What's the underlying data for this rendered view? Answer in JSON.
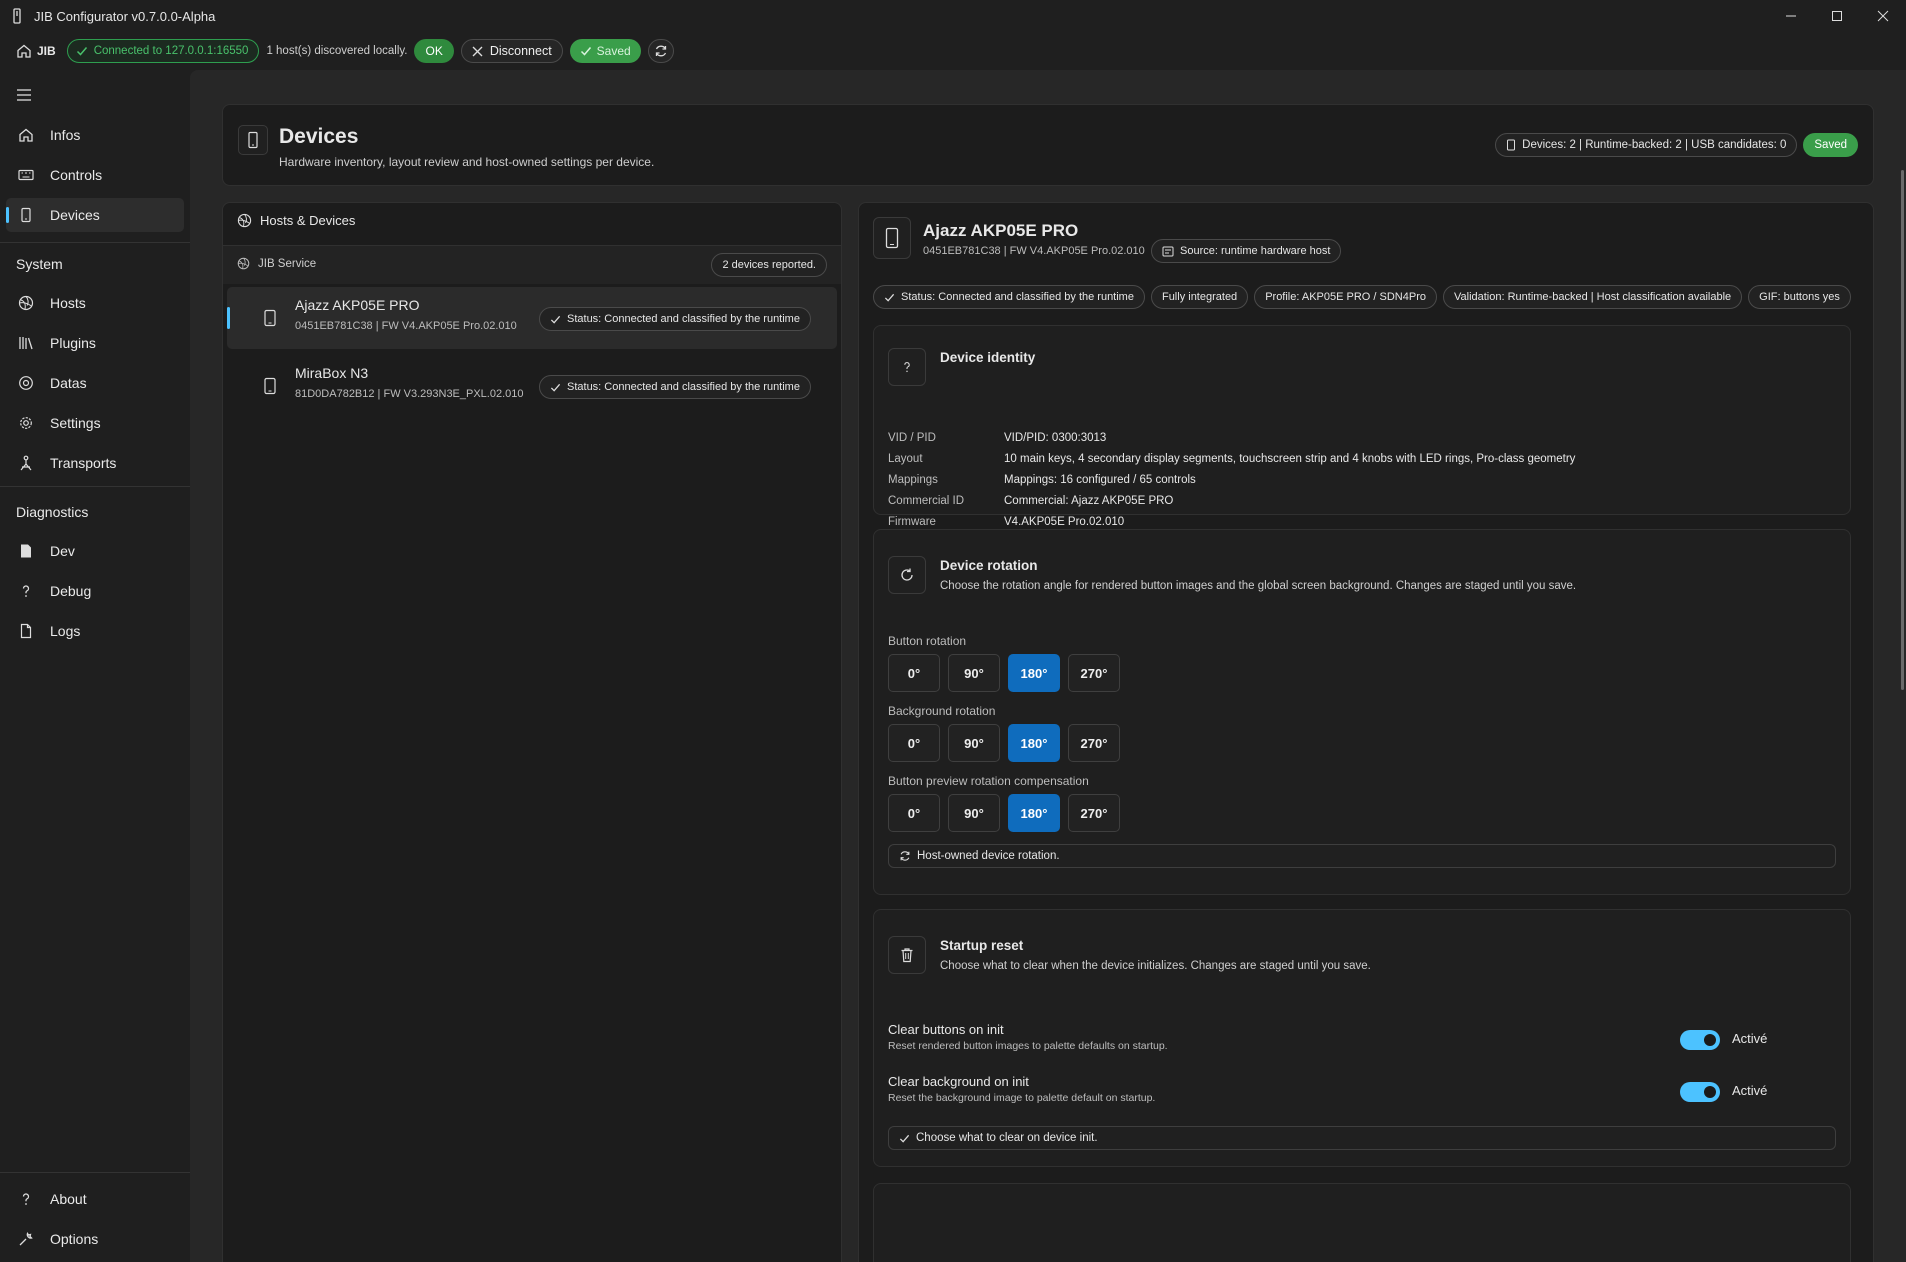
{
  "window": {
    "title": "JIB Configurator v0.7.0.0-Alpha"
  },
  "toolbar": {
    "home_label": "JIB",
    "connection": "Connected to 127.0.0.1:16550",
    "discovered": "1 host(s) discovered locally.",
    "ok_label": "OK",
    "disconnect_label": "Disconnect",
    "saved_label": "Saved"
  },
  "sidebar": {
    "top_items": [
      {
        "label": "Infos",
        "icon": "home-icon"
      },
      {
        "label": "Controls",
        "icon": "keyboard-icon"
      },
      {
        "label": "Devices",
        "icon": "phone-icon",
        "active": true
      }
    ],
    "system_header": "System",
    "system_items": [
      {
        "label": "Hosts",
        "icon": "globe-icon"
      },
      {
        "label": "Plugins",
        "icon": "library-icon"
      },
      {
        "label": "Datas",
        "icon": "database-icon"
      },
      {
        "label": "Settings",
        "icon": "gear-icon"
      },
      {
        "label": "Transports",
        "icon": "transport-icon"
      }
    ],
    "diag_header": "Diagnostics",
    "diag_items": [
      {
        "label": "Dev",
        "icon": "file-icon"
      },
      {
        "label": "Debug",
        "icon": "question-icon"
      },
      {
        "label": "Logs",
        "icon": "document-icon"
      }
    ],
    "bottom_items": [
      {
        "label": "About",
        "icon": "question-icon"
      },
      {
        "label": "Options",
        "icon": "wrench-icon"
      }
    ]
  },
  "header": {
    "title": "Devices",
    "subtitle": "Hardware inventory, layout review and host-owned settings per device.",
    "stats": "Devices: 2  |  Runtime-backed: 2  |  USB candidates: 0",
    "saved": "Saved"
  },
  "hosts_panel": {
    "title": "Hosts & Devices",
    "service": "JIB Service",
    "count": "2 devices reported.",
    "devices": [
      {
        "name": "Ajazz AKP05E PRO",
        "meta": "0451EB781C38  |  FW V4.AKP05E Pro.02.010",
        "status": "Status: Connected and classified by the runtime",
        "selected": true
      },
      {
        "name": "MiraBox N3",
        "meta": "81D0DA782B12  |  FW V3.293N3E_PXL.02.010",
        "status": "Status: Connected and classified by the runtime",
        "selected": false
      }
    ]
  },
  "detail": {
    "name": "Ajazz AKP05E PRO",
    "meta": "0451EB781C38  |  FW V4.AKP05E Pro.02.010",
    "source": "Source: runtime hardware host",
    "badges": [
      "Status: Connected and classified by the runtime",
      "Fully integrated",
      "Profile: AKP05E PRO / SDN4Pro",
      "Validation: Runtime-backed  |  Host classification available",
      "GIF: buttons yes"
    ],
    "identity": {
      "title": "Device identity",
      "rows": [
        {
          "k": "VID / PID",
          "v": "VID/PID: 0300:3013"
        },
        {
          "k": "Layout",
          "v": "10 main keys, 4 secondary display segments, touchscreen strip and 4 knobs with LED rings, Pro-class geometry"
        },
        {
          "k": "Mappings",
          "v": "Mappings: 16 configured / 65 controls"
        },
        {
          "k": "Commercial ID",
          "v": "Commercial: Ajazz AKP05E PRO"
        },
        {
          "k": "Firmware",
          "v": "V4.AKP05E Pro.02.010"
        }
      ]
    },
    "rotation": {
      "title": "Device rotation",
      "desc": "Choose the rotation angle for rendered button images and the global screen background. Changes are staged until you save.",
      "groups": [
        {
          "label": "Button rotation",
          "options": [
            "0°",
            "90°",
            "180°",
            "270°"
          ],
          "selected": "180°"
        },
        {
          "label": "Background rotation",
          "options": [
            "0°",
            "90°",
            "180°",
            "270°"
          ],
          "selected": "180°"
        },
        {
          "label": "Button preview rotation compensation",
          "options": [
            "0°",
            "90°",
            "180°",
            "270°"
          ],
          "selected": "180°"
        }
      ],
      "note": "Host-owned device rotation."
    },
    "startup": {
      "title": "Startup reset",
      "desc": "Choose what to clear when the device initializes. Changes are staged until you save.",
      "items": [
        {
          "title": "Clear buttons on init",
          "desc": "Reset rendered button images to palette defaults on startup.",
          "state": "Activé"
        },
        {
          "title": "Clear background on init",
          "desc": "Reset the background image to palette default on startup.",
          "state": "Activé"
        }
      ],
      "note": "Choose what to clear on device init."
    }
  },
  "colors": {
    "accent": "#4cc2ff",
    "selected": "#0f6cbd",
    "success": "#2f8a3d"
  }
}
